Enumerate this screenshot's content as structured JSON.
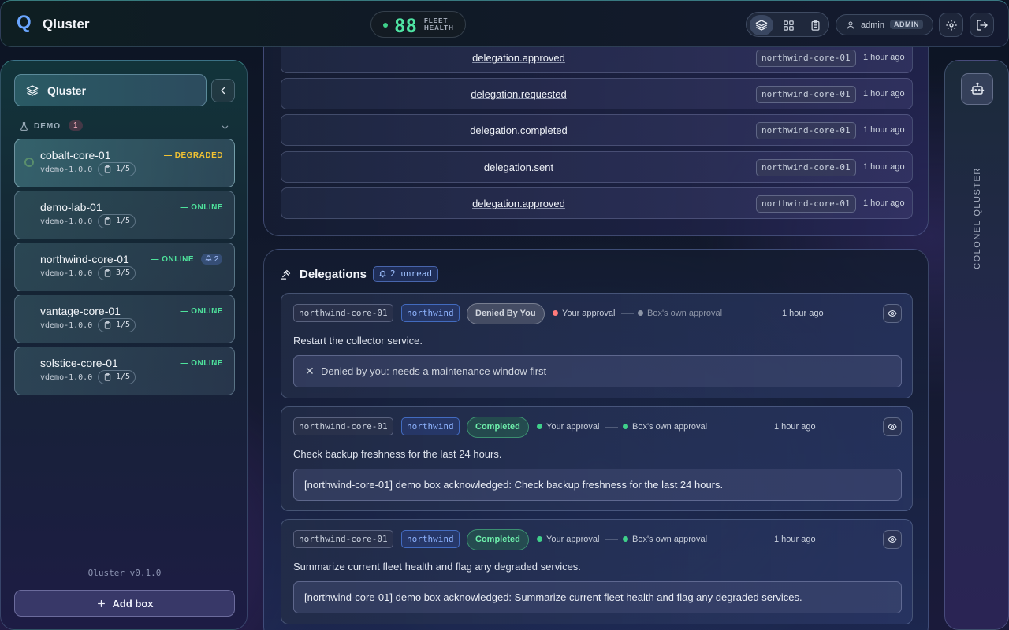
{
  "header": {
    "logo": "Q",
    "title": "Qluster",
    "fleet_health": {
      "value": "88",
      "label_line1": "FLEET",
      "label_line2": "HEALTH"
    },
    "toolbar": {
      "icons": [
        "layers-icon",
        "grid-icon",
        "clipboard-icon"
      ],
      "active": "layers-icon"
    },
    "user": {
      "name": "admin",
      "role": "ADMIN"
    }
  },
  "sidebar": {
    "title": "Qluster",
    "group": {
      "label": "DEMO",
      "count": "1"
    },
    "boxes": [
      {
        "name": "cobalt-core-01",
        "version": "vdemo-1.0.0",
        "slots": "1/5",
        "status": "— DEGRADED",
        "notifications": ""
      },
      {
        "name": "demo-lab-01",
        "version": "vdemo-1.0.0",
        "slots": "1/5",
        "status": "— ONLINE",
        "notifications": ""
      },
      {
        "name": "northwind-core-01",
        "version": "vdemo-1.0.0",
        "slots": "3/5",
        "status": "— ONLINE",
        "notifications": "2"
      },
      {
        "name": "vantage-core-01",
        "version": "vdemo-1.0.0",
        "slots": "1/5",
        "status": "— ONLINE",
        "notifications": ""
      },
      {
        "name": "solstice-core-01",
        "version": "vdemo-1.0.0",
        "slots": "1/5",
        "status": "— ONLINE",
        "notifications": ""
      }
    ],
    "version": "Qluster v0.1.0",
    "add_box_label": "Add box"
  },
  "events": [
    {
      "name": "delegation.approved",
      "box": "northwind-core-01",
      "time": "1 hour ago"
    },
    {
      "name": "delegation.requested",
      "box": "northwind-core-01",
      "time": "1 hour ago"
    },
    {
      "name": "delegation.completed",
      "box": "northwind-core-01",
      "time": "1 hour ago"
    },
    {
      "name": "delegation.sent",
      "box": "northwind-core-01",
      "time": "1 hour ago"
    },
    {
      "name": "delegation.approved",
      "box": "northwind-core-01",
      "time": "1 hour ago"
    }
  ],
  "delegations": {
    "title": "Delegations",
    "unread_badge": "2 unread",
    "items": [
      {
        "box": "northwind-core-01",
        "repo": "northwind",
        "state": "Denied By You",
        "your_approval": "Your approval",
        "box_approval": "Box's own approval",
        "time": "1 hour ago",
        "task": "Restart the collector service.",
        "result": "Denied by you: needs a maintenance window first"
      },
      {
        "box": "northwind-core-01",
        "repo": "northwind",
        "state": "Completed",
        "your_approval": "Your approval",
        "box_approval": "Box's own approval",
        "time": "1 hour ago",
        "task": "Check backup freshness for the last 24 hours.",
        "result": "[northwind-core-01] demo box acknowledged: Check backup freshness for the last 24 hours."
      },
      {
        "box": "northwind-core-01",
        "repo": "northwind",
        "state": "Completed",
        "your_approval": "Your approval",
        "box_approval": "Box's own approval",
        "time": "1 hour ago",
        "task": "Summarize current fleet health and flag any degraded services.",
        "result": "[northwind-core-01] demo box acknowledged: Summarize current fleet health and flag any degraded services."
      }
    ]
  },
  "right_rail": {
    "label": "COLONEL QLUSTER",
    "icon": "robot-icon"
  },
  "colors": {
    "online": "#4ee39c",
    "degraded": "#f1c232",
    "denied_dot": "#ff7a7a",
    "approved_dot": "#3fd08a",
    "accent": "#6aa6ff"
  }
}
